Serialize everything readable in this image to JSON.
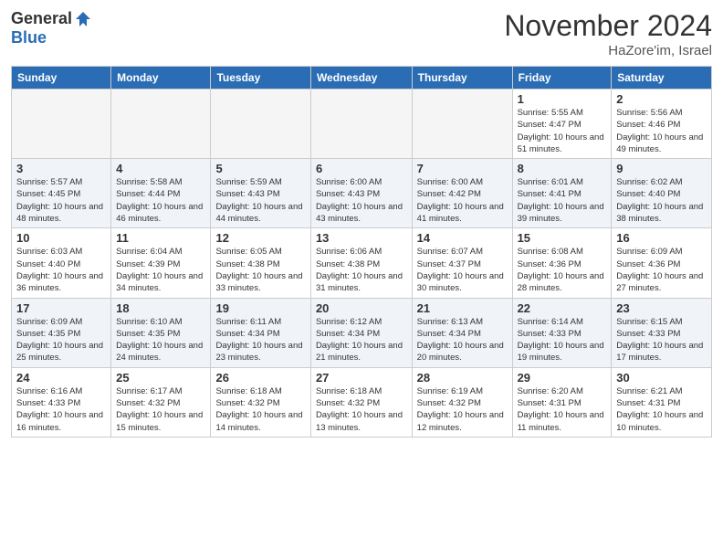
{
  "logo": {
    "general": "General",
    "blue": "Blue"
  },
  "header": {
    "month": "November 2024",
    "location": "HaZore'im, Israel"
  },
  "weekdays": [
    "Sunday",
    "Monday",
    "Tuesday",
    "Wednesday",
    "Thursday",
    "Friday",
    "Saturday"
  ],
  "weeks": [
    [
      {
        "day": "",
        "info": ""
      },
      {
        "day": "",
        "info": ""
      },
      {
        "day": "",
        "info": ""
      },
      {
        "day": "",
        "info": ""
      },
      {
        "day": "",
        "info": ""
      },
      {
        "day": "1",
        "info": "Sunrise: 5:55 AM\nSunset: 4:47 PM\nDaylight: 10 hours and 51 minutes."
      },
      {
        "day": "2",
        "info": "Sunrise: 5:56 AM\nSunset: 4:46 PM\nDaylight: 10 hours and 49 minutes."
      }
    ],
    [
      {
        "day": "3",
        "info": "Sunrise: 5:57 AM\nSunset: 4:45 PM\nDaylight: 10 hours and 48 minutes."
      },
      {
        "day": "4",
        "info": "Sunrise: 5:58 AM\nSunset: 4:44 PM\nDaylight: 10 hours and 46 minutes."
      },
      {
        "day": "5",
        "info": "Sunrise: 5:59 AM\nSunset: 4:43 PM\nDaylight: 10 hours and 44 minutes."
      },
      {
        "day": "6",
        "info": "Sunrise: 6:00 AM\nSunset: 4:43 PM\nDaylight: 10 hours and 43 minutes."
      },
      {
        "day": "7",
        "info": "Sunrise: 6:00 AM\nSunset: 4:42 PM\nDaylight: 10 hours and 41 minutes."
      },
      {
        "day": "8",
        "info": "Sunrise: 6:01 AM\nSunset: 4:41 PM\nDaylight: 10 hours and 39 minutes."
      },
      {
        "day": "9",
        "info": "Sunrise: 6:02 AM\nSunset: 4:40 PM\nDaylight: 10 hours and 38 minutes."
      }
    ],
    [
      {
        "day": "10",
        "info": "Sunrise: 6:03 AM\nSunset: 4:40 PM\nDaylight: 10 hours and 36 minutes."
      },
      {
        "day": "11",
        "info": "Sunrise: 6:04 AM\nSunset: 4:39 PM\nDaylight: 10 hours and 34 minutes."
      },
      {
        "day": "12",
        "info": "Sunrise: 6:05 AM\nSunset: 4:38 PM\nDaylight: 10 hours and 33 minutes."
      },
      {
        "day": "13",
        "info": "Sunrise: 6:06 AM\nSunset: 4:38 PM\nDaylight: 10 hours and 31 minutes."
      },
      {
        "day": "14",
        "info": "Sunrise: 6:07 AM\nSunset: 4:37 PM\nDaylight: 10 hours and 30 minutes."
      },
      {
        "day": "15",
        "info": "Sunrise: 6:08 AM\nSunset: 4:36 PM\nDaylight: 10 hours and 28 minutes."
      },
      {
        "day": "16",
        "info": "Sunrise: 6:09 AM\nSunset: 4:36 PM\nDaylight: 10 hours and 27 minutes."
      }
    ],
    [
      {
        "day": "17",
        "info": "Sunrise: 6:09 AM\nSunset: 4:35 PM\nDaylight: 10 hours and 25 minutes."
      },
      {
        "day": "18",
        "info": "Sunrise: 6:10 AM\nSunset: 4:35 PM\nDaylight: 10 hours and 24 minutes."
      },
      {
        "day": "19",
        "info": "Sunrise: 6:11 AM\nSunset: 4:34 PM\nDaylight: 10 hours and 23 minutes."
      },
      {
        "day": "20",
        "info": "Sunrise: 6:12 AM\nSunset: 4:34 PM\nDaylight: 10 hours and 21 minutes."
      },
      {
        "day": "21",
        "info": "Sunrise: 6:13 AM\nSunset: 4:34 PM\nDaylight: 10 hours and 20 minutes."
      },
      {
        "day": "22",
        "info": "Sunrise: 6:14 AM\nSunset: 4:33 PM\nDaylight: 10 hours and 19 minutes."
      },
      {
        "day": "23",
        "info": "Sunrise: 6:15 AM\nSunset: 4:33 PM\nDaylight: 10 hours and 17 minutes."
      }
    ],
    [
      {
        "day": "24",
        "info": "Sunrise: 6:16 AM\nSunset: 4:33 PM\nDaylight: 10 hours and 16 minutes."
      },
      {
        "day": "25",
        "info": "Sunrise: 6:17 AM\nSunset: 4:32 PM\nDaylight: 10 hours and 15 minutes."
      },
      {
        "day": "26",
        "info": "Sunrise: 6:18 AM\nSunset: 4:32 PM\nDaylight: 10 hours and 14 minutes."
      },
      {
        "day": "27",
        "info": "Sunrise: 6:18 AM\nSunset: 4:32 PM\nDaylight: 10 hours and 13 minutes."
      },
      {
        "day": "28",
        "info": "Sunrise: 6:19 AM\nSunset: 4:32 PM\nDaylight: 10 hours and 12 minutes."
      },
      {
        "day": "29",
        "info": "Sunrise: 6:20 AM\nSunset: 4:31 PM\nDaylight: 10 hours and 11 minutes."
      },
      {
        "day": "30",
        "info": "Sunrise: 6:21 AM\nSunset: 4:31 PM\nDaylight: 10 hours and 10 minutes."
      }
    ]
  ]
}
